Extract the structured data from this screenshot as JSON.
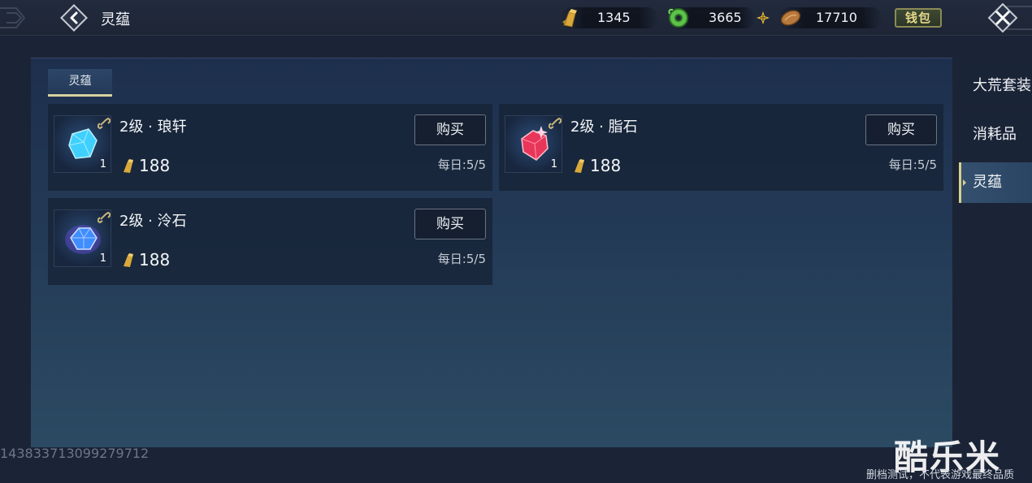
{
  "header": {
    "title": "灵蕴",
    "currencies": [
      {
        "icon": "gold-ingot-icon",
        "value": "1345"
      },
      {
        "icon": "jade-coin-icon",
        "value": "3665"
      },
      {
        "icon": "copper-coin-icon",
        "value": "17710"
      }
    ],
    "wallet_label": "钱包"
  },
  "panel": {
    "tab_label": "灵蕴",
    "items": [
      {
        "name": "2级 · 琅轩",
        "count": "1",
        "price": "188",
        "buy_label": "购买",
        "daily": "每日:5/5",
        "gem_color": "#3fd0ff"
      },
      {
        "name": "2级 · 脂石",
        "count": "1",
        "price": "188",
        "buy_label": "购买",
        "daily": "每日:5/5",
        "gem_color": "#e8365a"
      },
      {
        "name": "2级 · 泠石",
        "count": "1",
        "price": "188",
        "buy_label": "购买",
        "daily": "每日:5/5",
        "gem_color": "#3f8dff"
      }
    ]
  },
  "side_tabs": [
    {
      "label": "大荒套装",
      "active": false
    },
    {
      "label": "消耗品",
      "active": false
    },
    {
      "label": "灵蕴",
      "active": true
    }
  ],
  "footer": {
    "uid": "1438337130992​79712",
    "logo": "酷乐米",
    "disclaimer": "删档测试，不代表游戏最终品质"
  }
}
